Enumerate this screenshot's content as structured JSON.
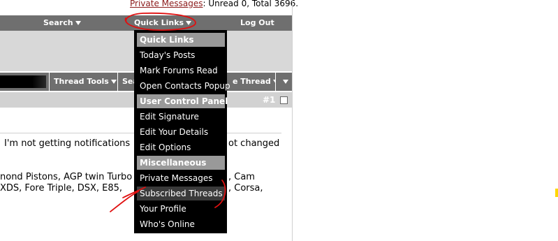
{
  "private_messages": {
    "link_label": "Private Messages",
    "status_text": ": Unread 0, Total 3696."
  },
  "navbar": {
    "search_label": "Search",
    "quick_links_label": "Quick Links",
    "logout_label": "Log Out"
  },
  "thread_toolbar": {
    "thread_tools_label": "Thread Tools",
    "search_thread_label": "Sea",
    "rate_thread_label": "e Thread"
  },
  "post": {
    "number": "#1",
    "line1_left": "I'm not getting notifications",
    "line1_right": "ot changed",
    "line2_left": "nond Pistons, AGP twin Turbo",
    "line2_right": ", Cam",
    "line3_left": " XDS, Fore Triple, DSX, E85,",
    "line3_right": ", Corsa,"
  },
  "quick_links_menu": {
    "sections": [
      {
        "header": "Quick Links",
        "items": [
          "Today's Posts",
          "Mark Forums Read",
          "Open Contacts Popup"
        ]
      },
      {
        "header": "User Control Panel",
        "items": [
          "Edit Signature",
          "Edit Your Details",
          "Edit Options"
        ]
      },
      {
        "header": "Miscellaneous",
        "items": [
          "Private Messages",
          "Subscribed Threads",
          "Your Profile",
          "Who's Online"
        ]
      }
    ],
    "highlighted_item": "Subscribed Threads"
  },
  "colors": {
    "navbar_bg": "#6f6f6f",
    "menu_bg": "#000000",
    "menu_header_bg": "#999999",
    "annotation_red": "#e01010",
    "link_color": "#8b1a1a"
  },
  "icons": [
    "caret-down-icon",
    "checkbox-icon"
  ]
}
